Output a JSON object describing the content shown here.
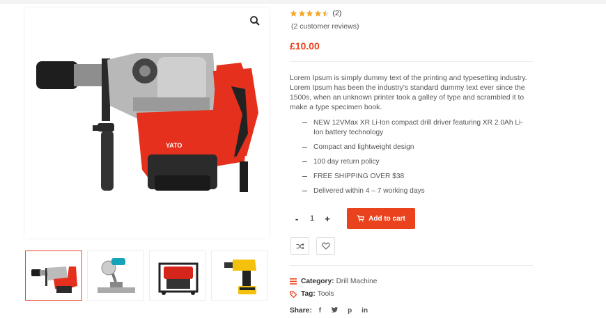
{
  "product": {
    "rating_value": 4.5,
    "rating_count": "(2)",
    "reviews_link": "(2 customer reviews)",
    "price": "£10.00",
    "description": "Lorem Ipsum is simply dummy text of the printing and typesetting industry. Lorem Ipsum has been the industry's standard dummy text ever since the 1500s, when an unknown printer took a galley of type and scrambled it to make a type specimen book.",
    "features": [
      "NEW 12VMax XR Li-Ion compact drill driver featuring XR 2.0Ah Li-Ion battery technology",
      "Compact and lightweight design",
      "100 day return policy",
      "FREE SHIPPING OVER $38",
      "Delivered within 4 – 7 working days"
    ],
    "image_brand_text": "YATO"
  },
  "cart": {
    "minus": "-",
    "quantity": "1",
    "plus": "+",
    "add_to_cart": "Add to cart"
  },
  "meta": {
    "category_label": "Category:",
    "category_value": "Drill Machine",
    "tag_label": "Tag:",
    "tag_value": "Tools",
    "share_label": "Share:",
    "share_icons": [
      "f",
      "t",
      "p",
      "in"
    ]
  },
  "colors": {
    "accent": "#e9421c",
    "star": "#f5a623",
    "text": "#555555"
  },
  "icons": {
    "zoom": "search-icon",
    "cart": "cart-icon",
    "compare": "shuffle-icon",
    "wishlist": "heart-icon",
    "category": "list-icon",
    "tag": "tag-icon"
  }
}
